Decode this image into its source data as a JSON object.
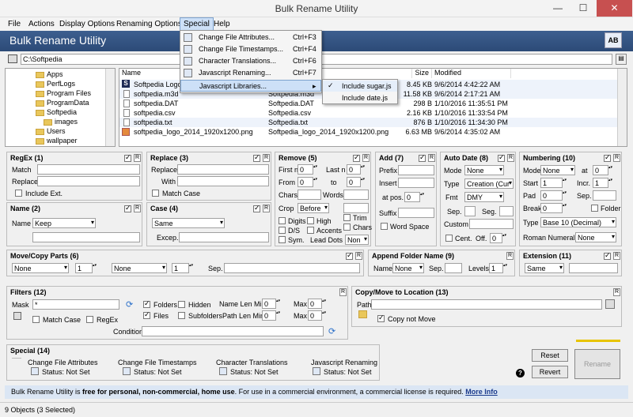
{
  "window": {
    "title": "Bulk Rename Utility",
    "minimize": "—",
    "maximize": "☐",
    "close": "✕"
  },
  "menu": [
    "File",
    "Actions",
    "Display Options",
    "Renaming Options",
    "Special",
    "Help"
  ],
  "app_header": "Bulk Rename Utility",
  "path": "C:\\Softpedia",
  "tree": [
    "Apps",
    "PerfLogs",
    "Program Files",
    "ProgramData",
    "Softpedia",
    "images",
    "Users",
    "wallpaper"
  ],
  "files": {
    "headers": [
      "Name",
      "Size",
      "Modified"
    ],
    "rows": [
      {
        "name": "Softpedia Logo.vi",
        "ext": "",
        "size": "8.45 KB",
        "mod": "9/6/2014 4:42:22 AM"
      },
      {
        "name": "softpedia.m3d",
        "ext": "Softpedia.m3d",
        "size": "11.58 KB",
        "mod": "9/6/2014 2:17:21 AM"
      },
      {
        "name": "softpedia.DAT",
        "ext": "Softpedia.DAT",
        "size": "298 B",
        "mod": "1/10/2016 11:35:51 PM"
      },
      {
        "name": "softpedia.csv",
        "ext": "Softpedia.csv",
        "size": "2.16 KB",
        "mod": "1/10/2016 11:33:54 PM"
      },
      {
        "name": "softpedia.txt",
        "ext": "Softpedia.txt",
        "size": "876 B",
        "mod": "1/10/2016 11:34:30 PM"
      },
      {
        "name": "softpedia_logo_2014_1920x1200.png",
        "ext": "Softpedia_logo_2014_1920x1200.png",
        "size": "6.63 MB",
        "mod": "9/6/2014 4:35:02 AM"
      }
    ]
  },
  "special_menu": [
    {
      "label": "Change File Attributes...",
      "shortcut": "Ctrl+F3"
    },
    {
      "label": "Change File Timestamps...",
      "shortcut": "Ctrl+F4"
    },
    {
      "label": "Character Translations...",
      "shortcut": "Ctrl+F6"
    },
    {
      "label": "Javascript Renaming...",
      "shortcut": "Ctrl+F7"
    },
    {
      "label": "Javascript Libraries...",
      "shortcut": ""
    }
  ],
  "submenu": [
    "Include sugar.js",
    "Include date.js"
  ],
  "regex": {
    "title": "RegEx (1)",
    "match": "Match",
    "replace": "Replace",
    "include_ext": "Include Ext."
  },
  "replace": {
    "title": "Replace (3)",
    "replace": "Replace",
    "with": "With",
    "match_case": "Match Case"
  },
  "remove": {
    "title": "Remove (5)",
    "first_n": "First n",
    "last_n": "Last n",
    "from": "From",
    "to": "to",
    "chars": "Chars",
    "words": "Words",
    "crop": "Crop",
    "crop_val": "Before",
    "digits": "Digits",
    "high": "High",
    "trim": "Trim",
    "ds": "D/S",
    "accents": "Accents",
    "chars2": "Chars",
    "sym": "Sym.",
    "lead_dots": "Lead Dots",
    "non": "Non",
    "zero": "0"
  },
  "add": {
    "title": "Add (7)",
    "prefix": "Prefix",
    "insert": "Insert",
    "at_pos": "at pos.",
    "suffix": "Suffix",
    "word_space": "Word Space",
    "zero": "0"
  },
  "autodate": {
    "title": "Auto Date (8)",
    "mode": "Mode",
    "mode_val": "None",
    "type": "Type",
    "type_val": "Creation (Cur",
    "fmt": "Fmt",
    "fmt_val": "DMY",
    "sep": "Sep.",
    "seg": "Seg.",
    "custom": "Custom",
    "cent": "Cent.",
    "off": "Off.",
    "zero": "0"
  },
  "numbering": {
    "title": "Numbering (10)",
    "mode": "Mode",
    "mode_val": "None",
    "at": "at",
    "start": "Start",
    "incr": "Incr.",
    "pad": "Pad",
    "sep": "Sep.",
    "break": "Break",
    "folder": "Folder",
    "type": "Type",
    "type_val": "Base 10 (Decimal)",
    "roman": "Roman Numerals",
    "roman_val": "None",
    "zero": "0",
    "one": "1"
  },
  "name": {
    "title": "Name (2)",
    "label": "Name",
    "value": "Keep"
  },
  "case": {
    "title": "Case (4)",
    "value": "Same",
    "excep": "Excep."
  },
  "move": {
    "title": "Move/Copy Parts (6)",
    "none": "None",
    "one": "1",
    "sep": "Sep."
  },
  "append": {
    "title": "Append Folder Name (9)",
    "name": "Name",
    "name_val": "None",
    "sep": "Sep.",
    "levels": "Levels",
    "levels_val": "1"
  },
  "extension": {
    "title": "Extension (11)",
    "value": "Same"
  },
  "filters": {
    "title": "Filters (12)",
    "mask": "Mask",
    "mask_val": "*",
    "folders": "Folders",
    "hidden": "Hidden",
    "files": "Files",
    "subfolders": "Subfolders",
    "name_len_min": "Name Len Min",
    "path_len_min": "Path Len Min",
    "max": "Max",
    "match_case": "Match Case",
    "regex": "RegEx",
    "condition": "Condition",
    "zero": "0"
  },
  "copymove": {
    "title": "Copy/Move to Location (13)",
    "path": "Path",
    "copy_not_move": "Copy not Move"
  },
  "special": {
    "title": "Special (14)",
    "items": [
      {
        "label": "Change File Attributes",
        "status": "Status: Not Set"
      },
      {
        "label": "Change File Timestamps",
        "status": "Status: Not Set"
      },
      {
        "label": "Character Translations",
        "status": "Status: Not Set"
      },
      {
        "label": "Javascript Renaming",
        "status": "Status: Not Set"
      }
    ]
  },
  "buttons": {
    "reset": "Reset",
    "revert": "Revert",
    "rename": "Rename",
    "help": "?"
  },
  "notice": {
    "prefix": "Bulk Rename Utility is",
    "bold": "free for personal, non-commercial, home use",
    "suffix": ". For use in a commercial environment, a commercial license is required.",
    "link": "More Info"
  },
  "status": "9 Objects (3 Selected)",
  "r_label": "R"
}
